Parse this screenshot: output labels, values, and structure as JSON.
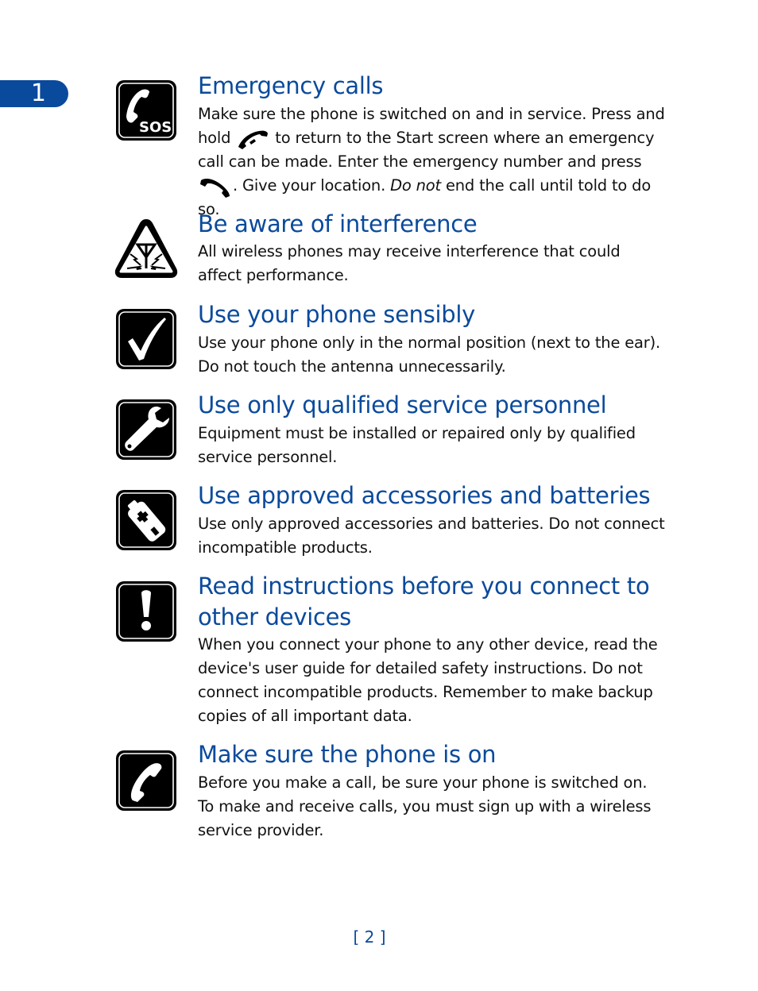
{
  "chapter": {
    "number": "1"
  },
  "sections": [
    {
      "icon": "phone-sos-icon",
      "title": "Emergency calls",
      "body": {
        "part1": "Make sure the phone is switched on and in service. Press and hold",
        "part2": "to return to the Start screen where an emergency call can be made. Enter the emergency number and press",
        "part3": ". Give your location.",
        "emphasis": "Do not",
        "part4": "end the call until told to do so."
      }
    },
    {
      "icon": "interference-warning-icon",
      "title": "Be aware of interference",
      "body": "All wireless phones may receive interference that could affect performance."
    },
    {
      "icon": "checkmark-icon",
      "title": "Use your phone sensibly",
      "body": "Use your phone only in the normal position (next to the ear). Do not touch the antenna unnecessarily."
    },
    {
      "icon": "wrench-icon",
      "title": "Use only qualified service personnel",
      "body": "Equipment must be installed or repaired only by qualified service personnel."
    },
    {
      "icon": "battery-icon",
      "title": "Use approved accessories and batteries",
      "body": "Use only approved accessories and batteries. Do not connect incompatible products."
    },
    {
      "icon": "exclamation-icon",
      "title": "Read instructions before you connect to other devices",
      "body": "When you connect your phone to any other device, read the device's user guide for detailed safety instructions. Do not connect incompatible products. Remember to make backup copies of all important data."
    },
    {
      "icon": "phone-icon",
      "title": "Make sure the phone is on",
      "body": "Before you make a call, be sure your phone is switched on. To make and receive calls, you must sign up with a wireless service provider."
    }
  ],
  "footer": {
    "page_number": "[ 2 ]"
  }
}
